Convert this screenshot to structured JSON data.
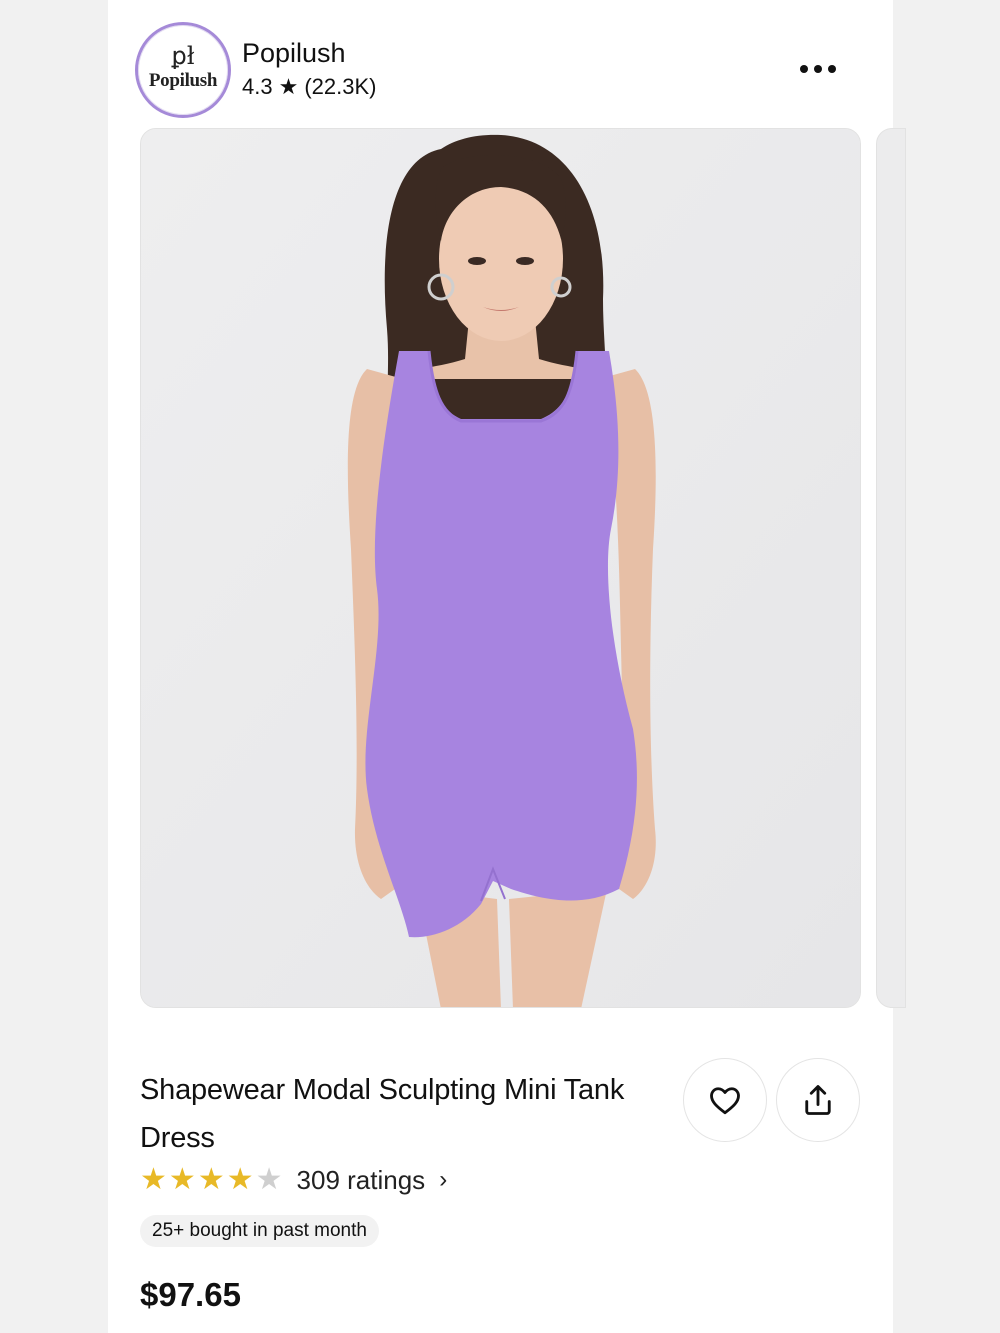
{
  "store": {
    "logo_mark": "ꝑł",
    "logo_text": "Popilush",
    "name": "Popilush",
    "rating": "4.3",
    "review_count": "(22.3K)"
  },
  "product": {
    "title": "Shapewear Modal Sculpting Mini Tank Dress",
    "star_rating": 4,
    "ratings_label": "309 ratings",
    "bought_badge": "25+ bought in past month",
    "price": "$97.65",
    "dress_color": "#a784e0"
  },
  "icons": {
    "more": "more-horizontal-icon",
    "favorite": "heart-icon",
    "share": "share-icon",
    "chevron": "chevron-right-icon"
  }
}
